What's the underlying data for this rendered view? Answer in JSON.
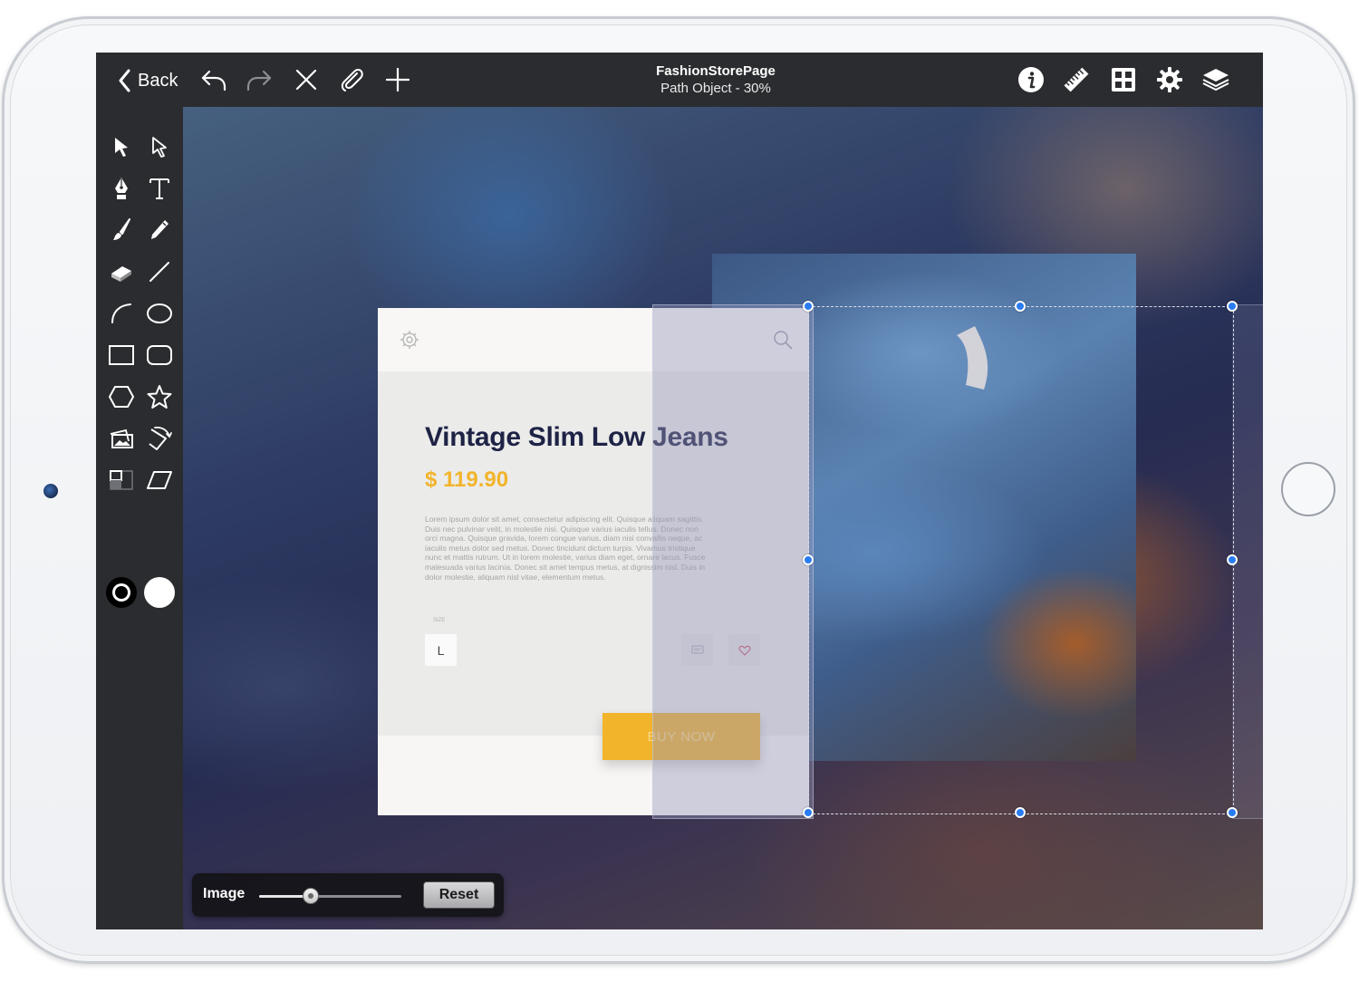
{
  "topbar": {
    "back_label": "Back",
    "title": "FashionStorePage",
    "subtitle": "Path Object - 30%",
    "left_icons": [
      "undo-icon",
      "redo-icon",
      "close-icon",
      "attach-icon",
      "add-icon"
    ],
    "right_icons": [
      "info-icon",
      "ruler-icon",
      "grid-icon",
      "gear-icon",
      "layers-icon"
    ]
  },
  "toolbox": {
    "tools": [
      "select-arrow",
      "direct-select-arrow",
      "pen",
      "text",
      "brush",
      "pencil",
      "eraser",
      "line",
      "arc",
      "ellipse",
      "rectangle",
      "rounded-rectangle",
      "hexagon",
      "star",
      "image-frame",
      "transform",
      "crop",
      "parallelogram"
    ],
    "stroke_color": "#000000",
    "fill_color": "#ffffff"
  },
  "card": {
    "title": "Vintage Slim Low Jeans",
    "price": "$ 119.90",
    "description": "Lorem ipsum dolor sit amet, consectetur adipiscing elit. Quisque aliquam sagittis. Duis nec pulvinar velit, in molestie nisi. Quisque varius iaculis tellus. Donec non orci magna. Quisque gravida, lorem congue varius, diam nisi convallis neque, ac iaculis metus dolor sed metus. Donec tincidunt dictum turpis. Vivamus tristique nunc et mattis rutrum. Ut in lorem molestie, varius diam eget, ornare lacus. Fusce malesuada varius lacinia. Donec sit amet tempus metus, at dignissim nisl. Duis in dolor molestie, aliquam nisl vitae, elementum metus.",
    "size_label": "SIZE",
    "size_value": "L",
    "buy_label": "BUY NOW",
    "accent": "#f2b42b",
    "title_color": "#1e2346"
  },
  "image_panel": {
    "label": "Image",
    "slider_value": 0.36,
    "reset_label": "Reset"
  },
  "colors": {
    "topbar_bg": "#2b2c2f",
    "selection_handle": "#2a7cf0"
  }
}
